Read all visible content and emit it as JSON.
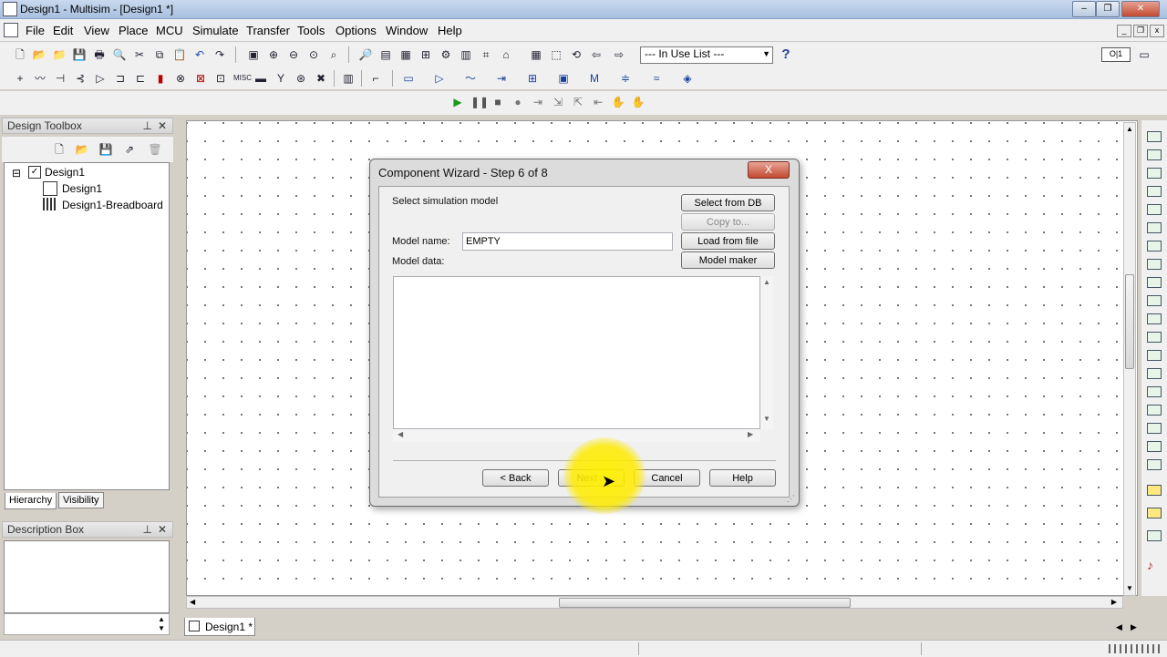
{
  "window": {
    "title": "Design1 - Multisim - [Design1 *]"
  },
  "menu": [
    "File",
    "Edit",
    "View",
    "Place",
    "MCU",
    "Simulate",
    "Transfer",
    "Tools",
    "Options",
    "Window",
    "Help"
  ],
  "toolbar": {
    "in_use_list": "--- In Use List ---",
    "help_icon": "?"
  },
  "design_toolbox": {
    "title": "Design Toolbox",
    "tree": [
      "Design1",
      "Design1",
      "Design1-Breadboard"
    ],
    "tabs": [
      "Hierarchy",
      "Visibility"
    ]
  },
  "description_box": {
    "title": "Description Box"
  },
  "document_tab": {
    "label": "Design1 *"
  },
  "dialog": {
    "title": "Component Wizard - Step 6 of 8",
    "close": "X",
    "heading": "Select simulation model",
    "model_name_label": "Model name:",
    "model_name_value": "EMPTY",
    "model_data_label": "Model data:",
    "buttons": {
      "select_from_db": "Select from DB",
      "copy_to": "Copy to...",
      "load_from_file": "Load from file",
      "model_maker": "Model maker",
      "back": "< Back",
      "next": "Next >",
      "cancel": "Cancel",
      "help": "Help"
    }
  }
}
